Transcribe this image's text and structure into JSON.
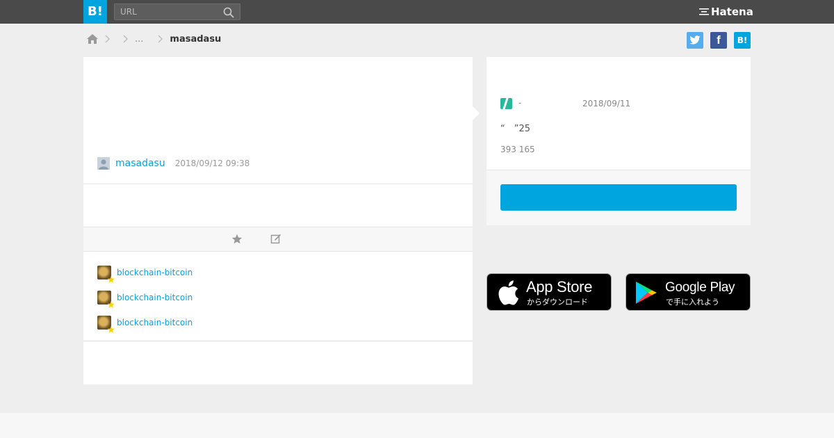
{
  "header": {
    "logo_text": "B!",
    "search_placeholder": "URL",
    "brand": "Hatena"
  },
  "breadcrumb": {
    "ellipsis": "...",
    "current": "masadasu"
  },
  "share": {
    "twitter_label": "",
    "facebook_label": "f",
    "hatena_label": "B!"
  },
  "entry": {
    "username": "masadasu",
    "datetime": "2018/09/12 09:38"
  },
  "stars": [
    {
      "name": "blockchain-bitcoin"
    },
    {
      "name": "blockchain-bitcoin"
    },
    {
      "name": "blockchain-bitcoin"
    }
  ],
  "sidebar": {
    "dash": "-",
    "date": "2018/09/11",
    "quote": "“　”25",
    "counts": "393 165",
    "button_label": ""
  },
  "badges": {
    "appstore_big": "App Store",
    "appstore_small": "からダウンロード",
    "googleplay_big": "Google Play",
    "googleplay_small": "で手に入れよう"
  },
  "colors": {
    "accent": "#00a4de",
    "topbar": "#4a4a4a",
    "hatena_green": "#29b89c",
    "twitter": "#55acee",
    "facebook": "#3b5998",
    "star": "#f7d400"
  }
}
